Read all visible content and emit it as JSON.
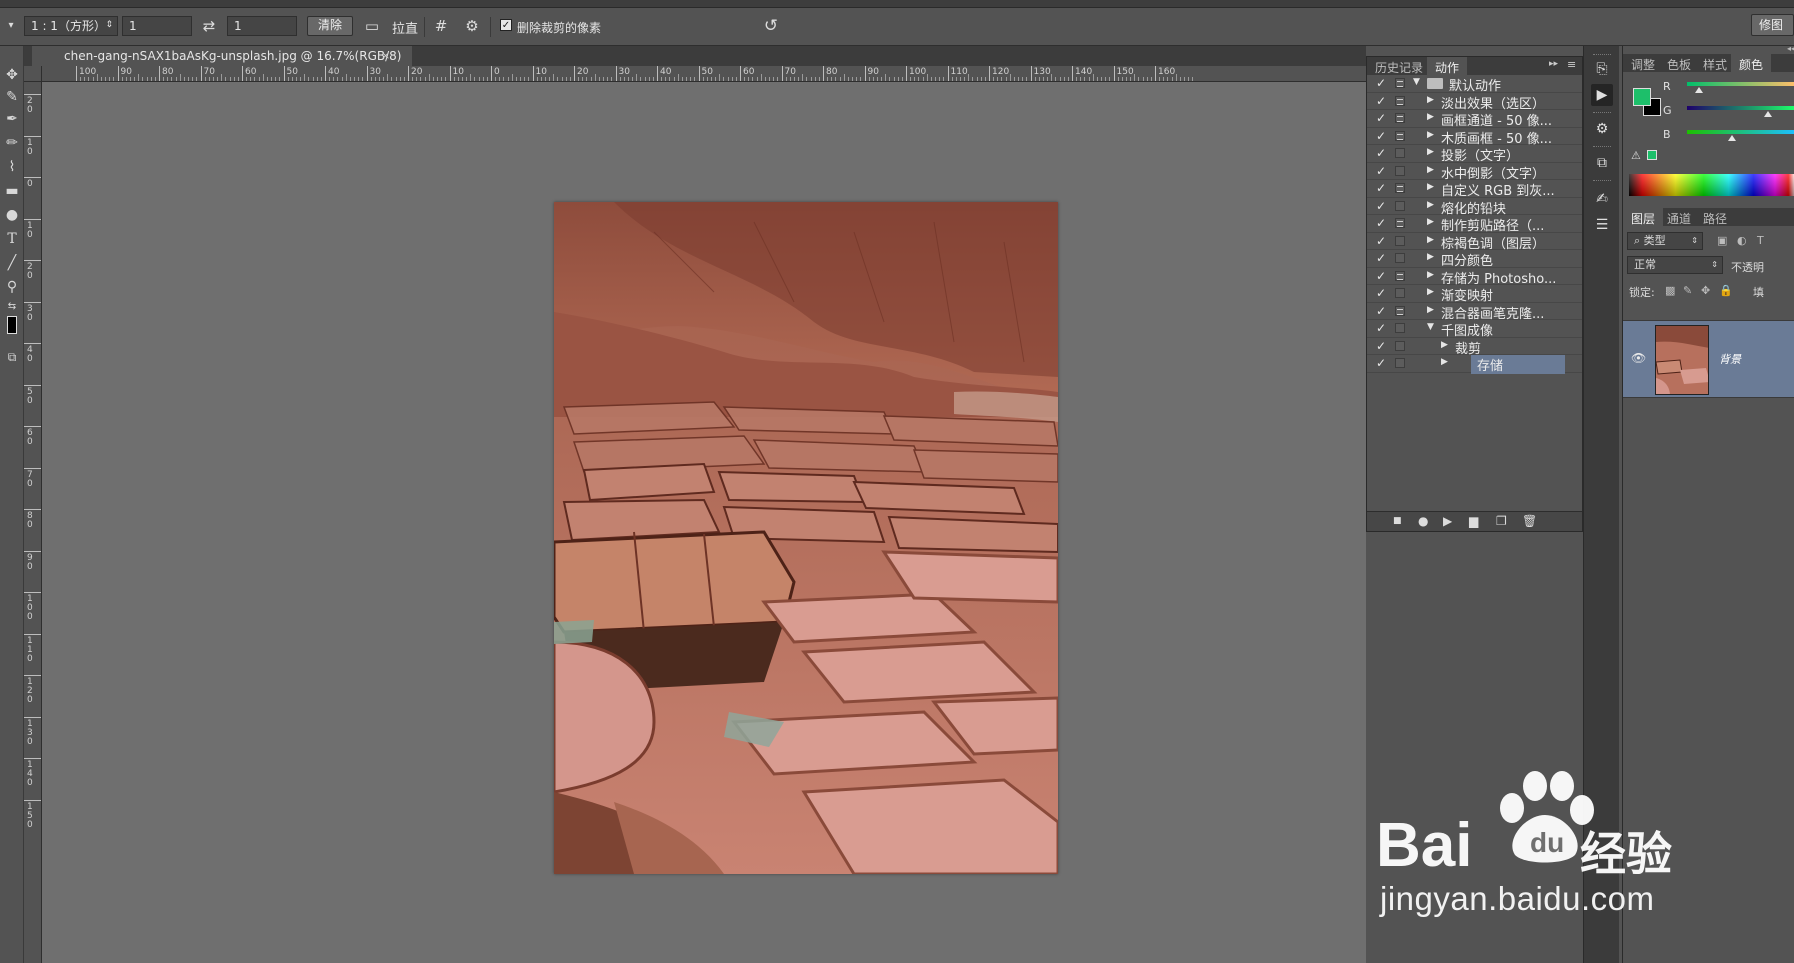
{
  "options_bar": {
    "ratio_preset": "1 : 1（方形）",
    "width_value": "1",
    "height_value": "1",
    "clear_label": "清除",
    "straighten_label": "拉直",
    "delete_cropped_label": "删除裁剪的像素",
    "delete_cropped_checked": "✓"
  },
  "workspace": {
    "label": "修图"
  },
  "document": {
    "tab_title": "chen-gang-nSAX1baAsKg-unsplash.jpg @ 16.7%(RGB/8)",
    "close_glyph": "×"
  },
  "rulers": {
    "horizontal_labels": [
      "100",
      "90",
      "80",
      "70",
      "60",
      "50",
      "40",
      "30",
      "20",
      "10",
      "0",
      "10",
      "20",
      "30",
      "40",
      "50",
      "60",
      "70",
      "80",
      "90",
      "100",
      "110",
      "120",
      "130",
      "140",
      "150",
      "160"
    ],
    "vertical_labels": [
      "20",
      "10",
      "0",
      "10",
      "20",
      "30",
      "40",
      "50",
      "60",
      "70",
      "80",
      "90",
      "100",
      "110",
      "120",
      "130",
      "140",
      "150"
    ]
  },
  "actions_panel": {
    "tabs": [
      {
        "label": "历史记录"
      },
      {
        "label": "动作"
      }
    ],
    "menu_glyph": "▸▸",
    "rows": [
      {
        "label": "默认动作",
        "dialog": true,
        "level": 0,
        "expanded": true,
        "folder": true
      },
      {
        "label": "淡出效果（选区）",
        "dialog": true,
        "level": 1
      },
      {
        "label": "画框通道 - 50 像...",
        "dialog": true,
        "level": 1
      },
      {
        "label": "木质画框 - 50 像...",
        "dialog": true,
        "level": 1
      },
      {
        "label": "投影（文字）",
        "dialog": false,
        "level": 1
      },
      {
        "label": "水中倒影（文字）",
        "dialog": false,
        "level": 1
      },
      {
        "label": "自定义 RGB 到灰...",
        "dialog": true,
        "level": 1
      },
      {
        "label": "熔化的铅块",
        "dialog": false,
        "level": 1
      },
      {
        "label": "制作剪贴路径（...",
        "dialog": true,
        "level": 1
      },
      {
        "label": "棕褐色调（图层）",
        "dialog": false,
        "level": 1
      },
      {
        "label": "四分颜色",
        "dialog": false,
        "level": 1
      },
      {
        "label": "存储为 Photosho...",
        "dialog": true,
        "level": 1
      },
      {
        "label": "渐变映射",
        "dialog": false,
        "level": 1
      },
      {
        "label": "混合器画笔克隆...",
        "dialog": true,
        "level": 1
      },
      {
        "label": "千图成像",
        "dialog": false,
        "level": 1,
        "expanded": true
      },
      {
        "label": "裁剪",
        "dialog": false,
        "level": 2
      },
      {
        "label": "存储",
        "dialog": false,
        "level": 2,
        "selected": true
      }
    ]
  },
  "color_panel": {
    "tabs": [
      {
        "label": "调整"
      },
      {
        "label": "色板"
      },
      {
        "label": "样式"
      },
      {
        "label": "颜色"
      }
    ],
    "channels": [
      {
        "name": "R",
        "value": 0.11
      },
      {
        "name": "G",
        "value": 0.75
      },
      {
        "name": "B",
        "value": 0.42
      }
    ],
    "foreground": "#1dbf6a",
    "background": "#000000"
  },
  "layers_panel": {
    "tabs": [
      {
        "label": "图层"
      },
      {
        "label": "通道"
      },
      {
        "label": "路径"
      }
    ],
    "filter_label": "类型",
    "blend_mode": "正常",
    "opacity_label": "不透明",
    "lock_label": "锁定:",
    "fill_label": "填",
    "layer_name": "背景"
  },
  "watermark": {
    "brand": "Bai",
    "brand_b": "经验",
    "url": "jingyan.baidu.com"
  }
}
